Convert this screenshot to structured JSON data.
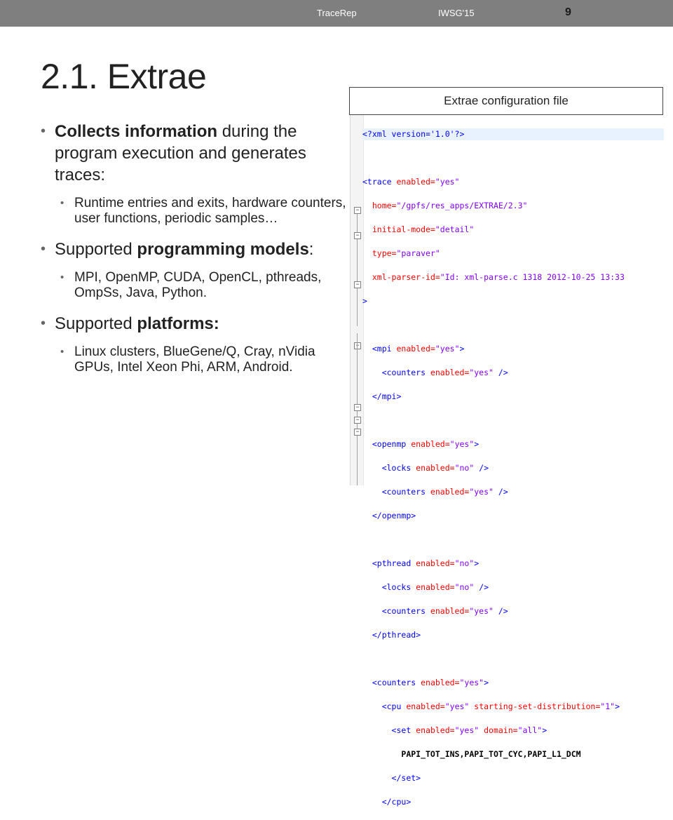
{
  "header": {
    "left": "TraceRep",
    "right": "IWSG'15",
    "page": "9"
  },
  "title": "2.1. Extrae",
  "bullets": [
    {
      "pre": "",
      "bold": "Collects information",
      "post": " during the program execution and generates traces:"
    },
    {
      "sub": "Runtime entries and exits, hardware counters, user functions, periodic samples…"
    },
    {
      "pre": "Supported ",
      "bold": "programming models",
      "post": ":"
    },
    {
      "sub": "MPI, OpenMP, CUDA, OpenCL, pthreads, OmpSs, Java, Python."
    },
    {
      "pre": "Supported ",
      "bold": "platforms:",
      "post": ""
    },
    {
      "sub": "Linux clusters, BlueGene/Q, Cray, nVidia GPUs, Intel Xeon Phi, ARM, Android."
    }
  ],
  "config_label": "Extrae configuration file",
  "code": {
    "l1_pi": "<?xml version='1.0'?>",
    "l3_tag": "<trace",
    "l3_attr": " enabled=",
    "l3_val": "\"yes\"",
    "l4_attr": "home=",
    "l4_val": "\"/gpfs/res_apps/EXTRAE/2.3\"",
    "l5_attr": "initial-mode=",
    "l5_val": "\"detail\"",
    "l6_attr": "type=",
    "l6_val": "\"paraver\"",
    "l7_attr": "xml-parser-id=",
    "l7_val": "\"Id: xml-parse.c 1318 2012-10-25 13:33",
    "l8": ">",
    "mpi_open": "<mpi",
    "mpi_attr": " enabled=",
    "mpi_val": "\"yes\"",
    "counters_tag": "<counters",
    "counters_attr": " enabled=",
    "counters_val": "\"yes\"",
    "self_close": " />",
    "mpi_close": "</mpi>",
    "openmp_open": "<openmp",
    "openmp_val": "\"yes\"",
    "locks_tag": "<locks",
    "locks_val": "\"no\"",
    "openmp_close": "</openmp>",
    "pthread_open": "<pthread",
    "pthread_val": "\"no\"",
    "pthread_close": "</pthread>",
    "cpu_open": "<cpu",
    "cpu_attr2": " starting-set-distribution=",
    "cpu_val2": "\"1\"",
    "set_open": "<set",
    "set_attr2": " domain=",
    "set_val2": "\"all\"",
    "set_text": "PAPI_TOT_INS,PAPI_TOT_CYC,PAPI_L1_DCM",
    "set_close": "</set>",
    "cpu_close": "</cpu>",
    "gt": ">"
  }
}
